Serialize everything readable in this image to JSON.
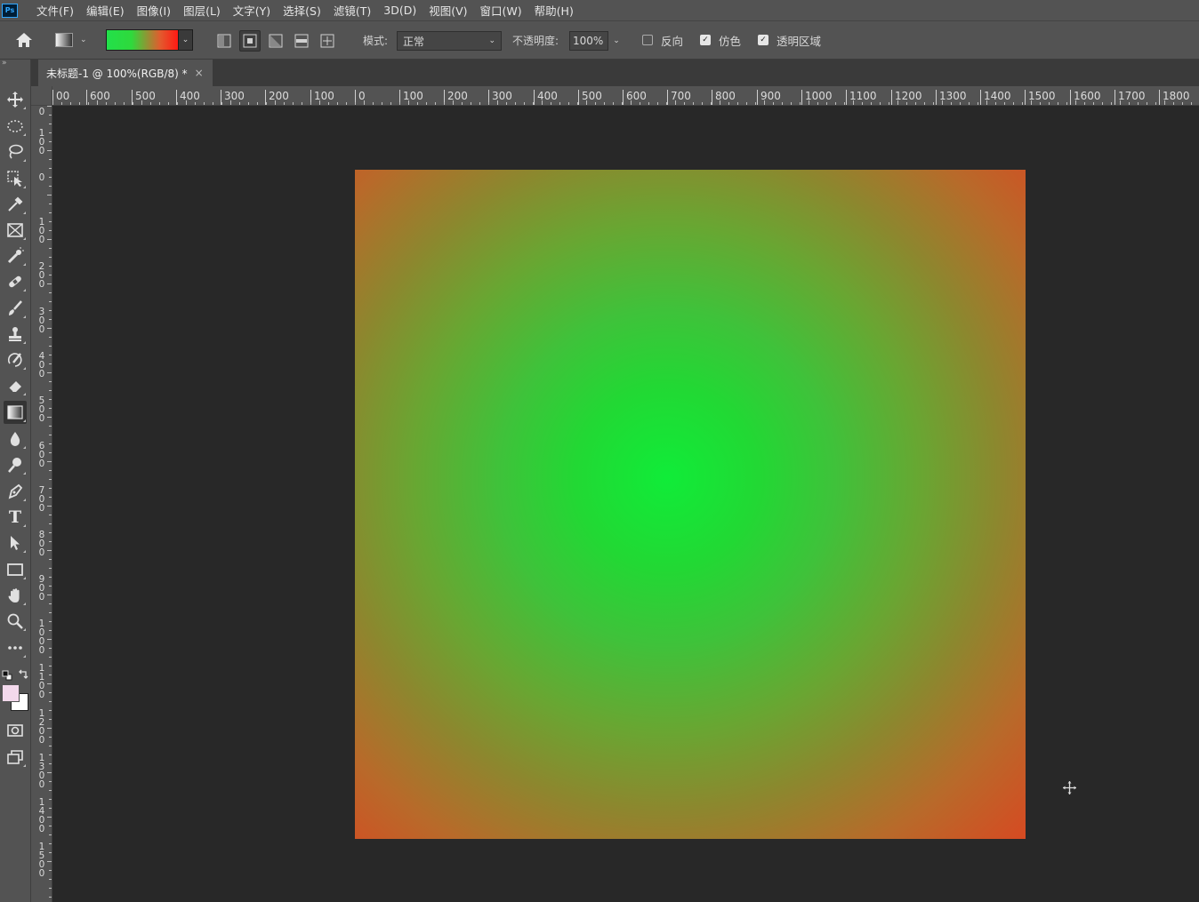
{
  "app": {
    "logo": "Ps"
  },
  "menu": [
    "文件(F)",
    "编辑(E)",
    "图像(I)",
    "图层(L)",
    "文字(Y)",
    "选择(S)",
    "滤镜(T)",
    "3D(D)",
    "视图(V)",
    "窗口(W)",
    "帮助(H)"
  ],
  "options": {
    "mode_label": "模式:",
    "mode_value": "正常",
    "opacity_label": "不透明度:",
    "opacity_value": "100%",
    "reverse_label": "反向",
    "reverse_checked": false,
    "dither_label": "仿色",
    "dither_checked": true,
    "transparency_label": "透明区域",
    "transparency_checked": true,
    "gradient_colors": [
      "#22e04a",
      "#ff1a14"
    ]
  },
  "document": {
    "tab_title": "未标题-1 @ 100%(RGB/8) *",
    "close_glyph": "×"
  },
  "ruler": {
    "h_labels": [
      "00",
      "600",
      "500",
      "400",
      "300",
      "200",
      "100",
      "0",
      "100",
      "200",
      "300",
      "400",
      "500",
      "600",
      "700",
      "800",
      "900",
      "1000",
      "1100",
      "1200",
      "1300",
      "1400",
      "1500",
      "1600",
      "1700",
      "1800"
    ],
    "v_labels": [
      "0",
      "100",
      "0",
      "100",
      "200",
      "300",
      "400",
      "500",
      "600",
      "700",
      "800",
      "900",
      "1000",
      "1100",
      "1200",
      "1300",
      "1400",
      "1500"
    ]
  },
  "tools": [
    "move-tool-icon",
    "elliptical-marquee-icon",
    "lasso-icon",
    "object-select-icon",
    "eyedropper-icon",
    "frame-tool-icon",
    "spot-heal-icon",
    "bandage-icon",
    "brush-icon",
    "clone-stamp-icon",
    "history-brush-icon",
    "eraser-icon",
    "gradient-tool-icon",
    "blur-icon",
    "dodge-icon",
    "pen-icon",
    "type-tool-icon",
    "path-select-icon",
    "rectangle-tool-icon",
    "hand-tool-icon",
    "zoom-tool-icon",
    "more-tools-icon"
  ],
  "colors": {
    "foreground": "#f3d9ec",
    "background": "#ffffff",
    "ui_panel": "#535353",
    "workspace": "#282828"
  },
  "type_tool_glyph": "T"
}
